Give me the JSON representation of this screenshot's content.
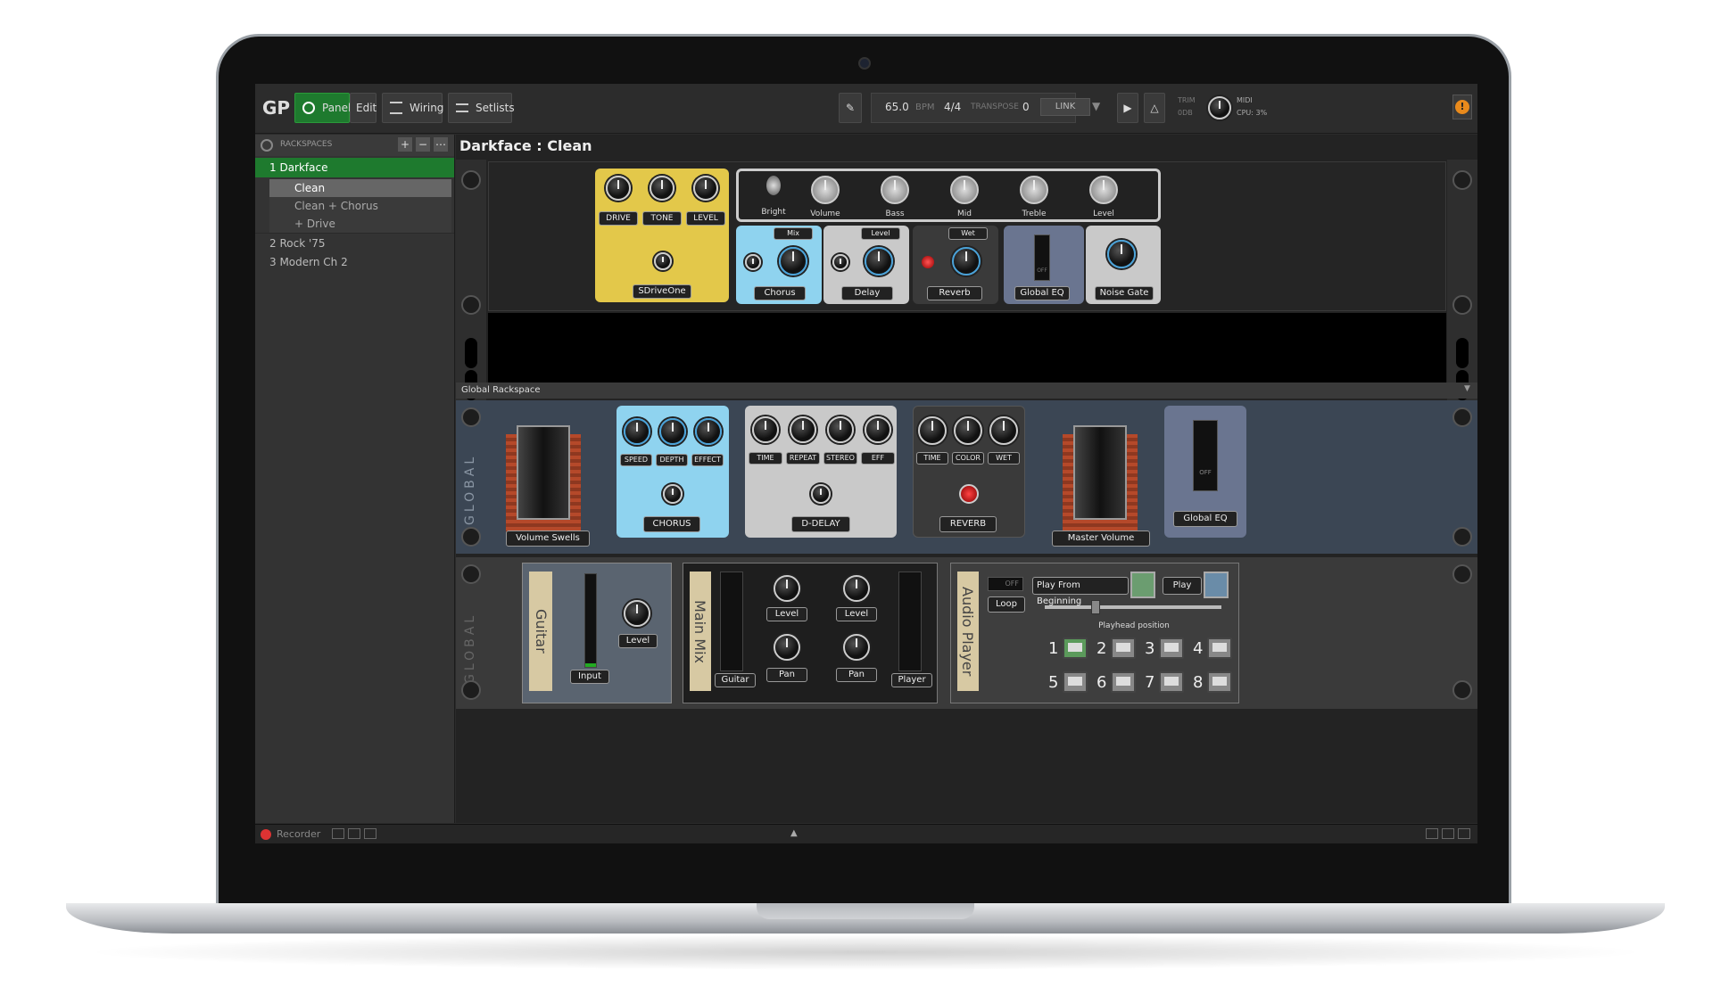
{
  "toolbar": {
    "panels": "Panels",
    "edit": "Edit",
    "wiring": "Wiring",
    "setlists": "Setlists",
    "bpm_value": "65.0",
    "bpm_unit": "BPM",
    "time_sig": "4/4",
    "transpose_label": "TRANSPOSE",
    "transpose_value": "0",
    "link": "LINK",
    "trim": "TRIM",
    "trim_value": "0dB",
    "midi": "MIDI",
    "cpu": "CPU: 3%"
  },
  "sidebar": {
    "header": "RACKSPACES",
    "items": [
      {
        "label": "1  Darkface",
        "selected": true
      },
      {
        "label": "Clean",
        "selected": true
      },
      {
        "label": "Clean + Chorus"
      },
      {
        "label": "+ Drive"
      },
      {
        "label": "2  Rock '75"
      },
      {
        "label": "3  Modern Ch 2"
      }
    ],
    "recorder": "Recorder"
  },
  "title": "Darkface : Clean",
  "rack": {
    "sdrive": {
      "knobs": [
        "DRIVE",
        "TONE",
        "LEVEL"
      ],
      "name": "SDriveOne"
    },
    "amp": {
      "labels": [
        "Bright",
        "Volume",
        "Bass",
        "Mid",
        "Treble",
        "Level"
      ]
    },
    "chorus": {
      "tag": "Mix",
      "name": "Chorus"
    },
    "delay": {
      "tag": "Level",
      "name": "Delay"
    },
    "reverb": {
      "tag": "Wet",
      "name": "Reverb"
    },
    "global_eq": {
      "name": "Global EQ",
      "switch": "OFF"
    },
    "noise_gate": {
      "name": "Noise Gate"
    }
  },
  "global_rack": {
    "header": "Global Rackspace",
    "side_label": "GLOBAL",
    "volume_swells": "Volume Swells",
    "chorus": {
      "knobs": [
        "SPEED",
        "DEPTH",
        "EFFECT"
      ],
      "name": "CHORUS"
    },
    "ddelay": {
      "knobs": [
        "TIME",
        "REPEAT",
        "STEREO",
        "EFF"
      ],
      "name": "D-DELAY"
    },
    "reverb": {
      "knobs": [
        "TIME",
        "COLOR",
        "WET"
      ],
      "name": "REVERB"
    },
    "master_volume": "Master Volume",
    "global_eq": {
      "name": "Global EQ",
      "switch": "OFF"
    }
  },
  "global_rack2": {
    "side_label": "GLOBAL",
    "guitar": {
      "scribble": "Guitar",
      "input": "Input",
      "level": "Level"
    },
    "main_mix": {
      "scribble": "Main Mix",
      "level1": "Level",
      "level2": "Level",
      "pan1": "Pan",
      "pan2": "Pan",
      "guitar": "Guitar",
      "player": "Player"
    },
    "audio_player": {
      "scribble": "Audio Player",
      "off": "OFF",
      "loop": "Loop",
      "play_from_beginning": "Play From Beginning",
      "play": "Play",
      "playhead": "Playhead position",
      "numbers": [
        "1",
        "2",
        "3",
        "4",
        "5",
        "6",
        "7",
        "8"
      ]
    }
  },
  "colors": {
    "accent_green": "#1e7a2e",
    "sdrive": "#e3c84a",
    "chorus": "#8fd3ef",
    "grey": "#c9c9c9",
    "dark": "#3a3a3a",
    "panel_blue": "#3b4654"
  }
}
